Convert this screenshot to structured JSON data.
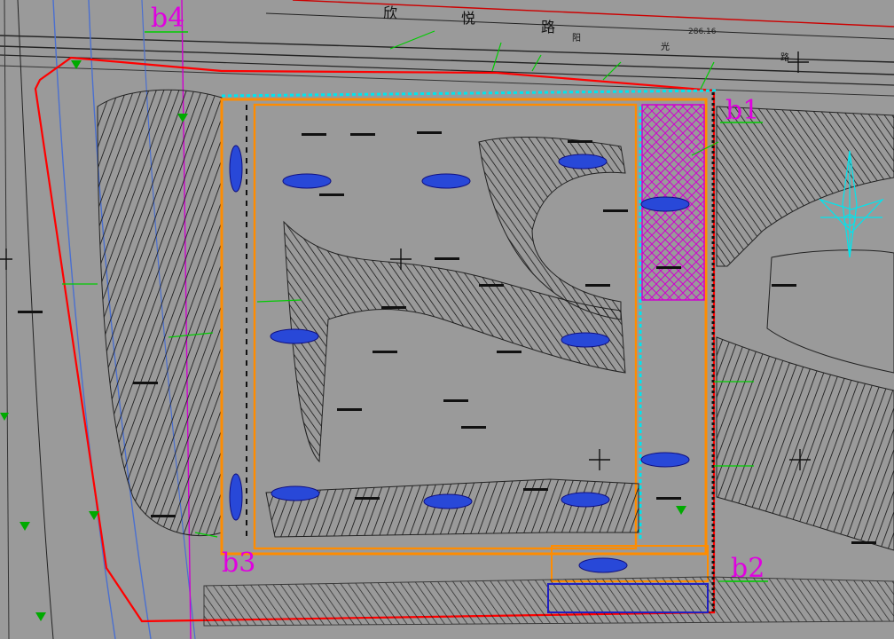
{
  "colors": {
    "background": "#9a9a9a",
    "red_boundary": "#ff0000",
    "orange_boundary": "#ff8c00",
    "cyan_wall": "#00e5ee",
    "magenta_hatch": "#d000d0",
    "blue_oval": "#1010d0",
    "purple_box": "#2020c0",
    "green_leader": "#00cc00",
    "label_magenta": "#e000e0"
  },
  "road": {
    "name_chars": [
      "欣",
      "悦",
      "路"
    ],
    "side_chars": [
      "阳",
      "光",
      "路"
    ]
  },
  "corner_points": [
    {
      "id": "b1",
      "label": "b1"
    },
    {
      "id": "b2",
      "label": "b2"
    },
    {
      "id": "b3",
      "label": "b3"
    },
    {
      "id": "b4",
      "label": "b4"
    }
  ],
  "top_right_numbers": {
    "n1": "286.16"
  },
  "icons": [
    "north-arrow-icon",
    "survey-triangle-icon",
    "cross-mark-icon"
  ]
}
